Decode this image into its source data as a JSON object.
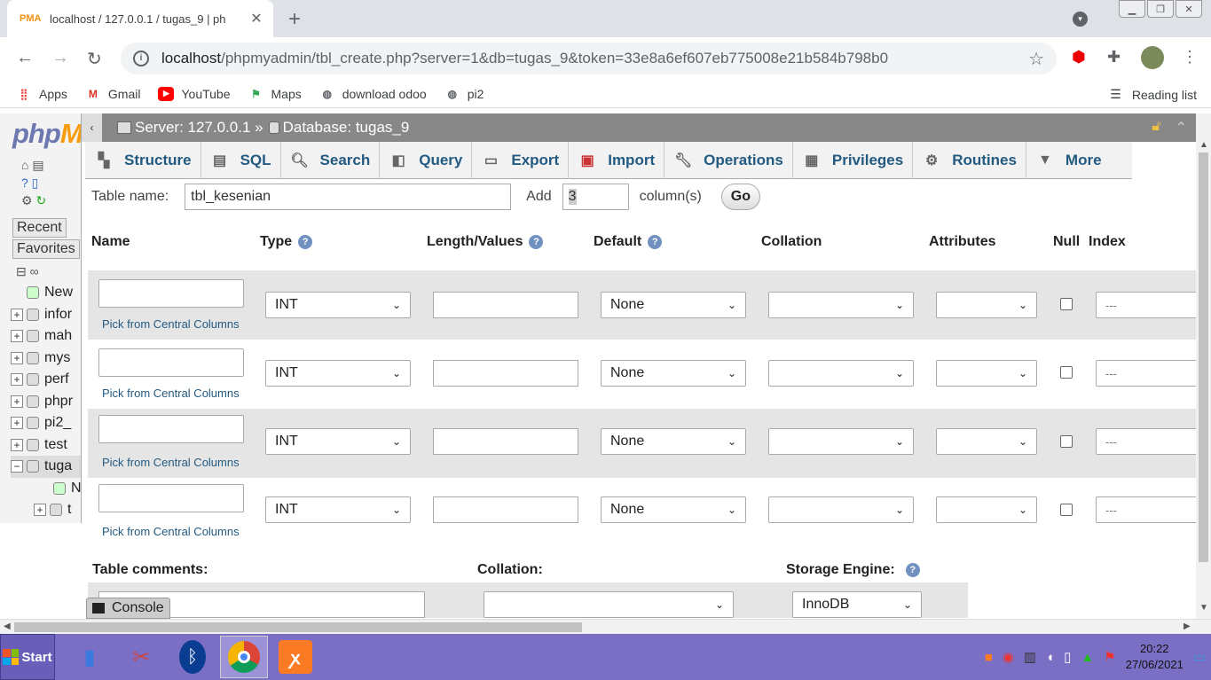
{
  "browser": {
    "tab_title": "localhost / 127.0.0.1 / tugas_9 | ph",
    "tab_icon": "PMA",
    "address_host": "localhost",
    "address_path": "/phpmyadmin/tbl_create.php?server=1&db=tugas_9&token=33e8a6ef607eb775008e21b584b798b0",
    "bookmarks": [
      {
        "label": "Apps",
        "icon": "apps-grid-icon"
      },
      {
        "label": "Gmail",
        "icon": "gmail-icon"
      },
      {
        "label": "YouTube",
        "icon": "youtube-icon"
      },
      {
        "label": "Maps",
        "icon": "maps-icon"
      },
      {
        "label": "download odoo",
        "icon": "globe-icon"
      },
      {
        "label": "pi2",
        "icon": "globe-icon"
      }
    ],
    "reading_list": "Reading list"
  },
  "pma": {
    "logo_a": "php",
    "logo_b": "M",
    "recent": "Recent",
    "favorites": "Favorites",
    "tree": [
      "New",
      "infor",
      "mah",
      "mys",
      "perf",
      "phpr",
      "pi2_",
      "test",
      "tuga",
      "N",
      "t"
    ],
    "breadcrumb_server": "Server: 127.0.0.1 »",
    "breadcrumb_db": "Database: tugas_9",
    "menu": [
      {
        "label": "Structure",
        "icon": "structure-icon"
      },
      {
        "label": "SQL",
        "icon": "sql-icon"
      },
      {
        "label": "Search",
        "icon": "search-icon"
      },
      {
        "label": "Query",
        "icon": "query-icon"
      },
      {
        "label": "Export",
        "icon": "export-icon"
      },
      {
        "label": "Import",
        "icon": "import-icon"
      },
      {
        "label": "Operations",
        "icon": "wrench-icon"
      },
      {
        "label": "Privileges",
        "icon": "privileges-icon"
      },
      {
        "label": "Routines",
        "icon": "routines-icon"
      },
      {
        "label": "More",
        "icon": "chevron-down-icon"
      }
    ],
    "table_name_label": "Table name:",
    "table_name_value": "tbl_kesenian",
    "add_label": "Add",
    "add_value": "3",
    "columns_label": "column(s)",
    "go_label": "Go",
    "headers": {
      "name": "Name",
      "type": "Type",
      "length": "Length/Values",
      "default": "Default",
      "collation": "Collation",
      "attributes": "Attributes",
      "null": "Null",
      "index": "Index"
    },
    "rows": [
      {
        "type": "INT",
        "default": "None",
        "index": "---",
        "pick": "Pick from Central Columns"
      },
      {
        "type": "INT",
        "default": "None",
        "index": "---",
        "pick": "Pick from Central Columns"
      },
      {
        "type": "INT",
        "default": "None",
        "index": "---",
        "pick": "Pick from Central Columns"
      },
      {
        "type": "INT",
        "default": "None",
        "index": "---",
        "pick": "Pick from Central Columns"
      }
    ],
    "table_comments_label": "Table comments:",
    "collation_label": "Collation:",
    "storage_engine_label": "Storage Engine:",
    "storage_engine_value": "InnoDB",
    "console_label": "Console"
  },
  "taskbar": {
    "start_label": "Start",
    "time": "20:22",
    "date": "27/06/2021"
  },
  "colors": {
    "pma_link": "#235a81",
    "taskbar": "#7a6fc4",
    "topbar": "#888888"
  }
}
